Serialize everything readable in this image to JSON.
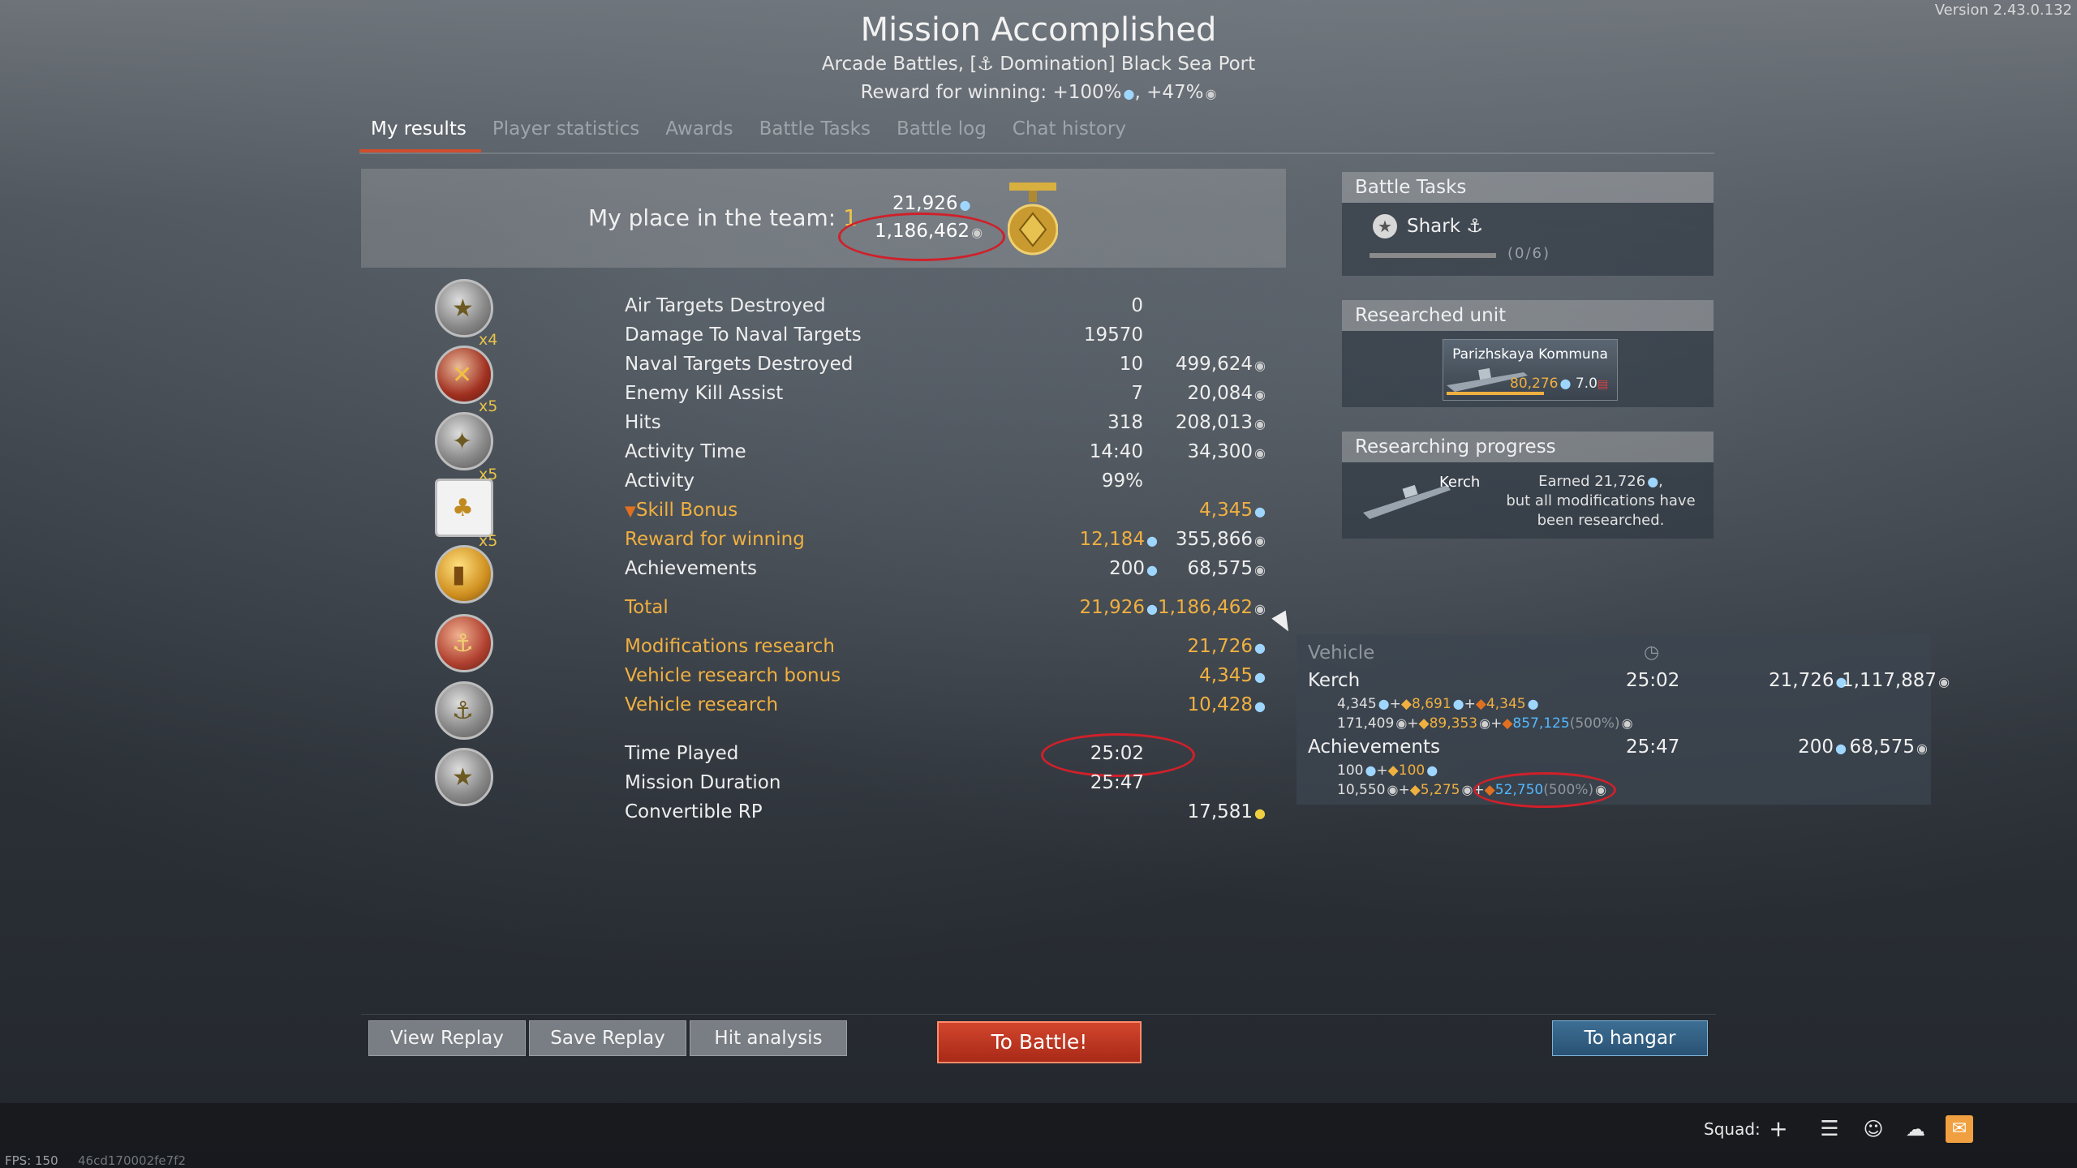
{
  "version": "Version 2.43.0.132",
  "header": {
    "title": "Mission Accomplished",
    "subtitle_prefix": "Arcade Battles, [",
    "subtitle_suffix": " Domination] Black Sea Port",
    "reward_text_1": "Reward for winning: +100%",
    "reward_text_2": ", +47%"
  },
  "tabs": [
    "My results",
    "Player statistics",
    "Awards",
    "Battle Tasks",
    "Battle log",
    "Chat history"
  ],
  "place": {
    "label": "My place in the team: ",
    "value": "1",
    "rp": "21,926",
    "sl": "1,186,462"
  },
  "stats": [
    {
      "label": "Air Targets Destroyed",
      "v1": "0",
      "v2": "",
      "gold": false
    },
    {
      "label": "Damage To Naval Targets",
      "v1": "19570",
      "v2": "",
      "gold": false
    },
    {
      "label": "Naval Targets Destroyed",
      "v1": "10",
      "v2": "499,624",
      "gold": false
    },
    {
      "label": "Enemy Kill Assist",
      "v1": "7",
      "v2": "20,084",
      "gold": false
    },
    {
      "label": "Hits",
      "v1": "318",
      "v2": "208,013",
      "gold": false
    },
    {
      "label": "Activity Time",
      "v1": "14:40",
      "v2": "34,300",
      "gold": false
    },
    {
      "label": "Activity",
      "v1": "99%",
      "v2": "",
      "gold": false
    },
    {
      "label": "Skill Bonus",
      "v1": "",
      "v2": "4,345",
      "gold": true
    },
    {
      "label": "Reward for winning",
      "v1": "12,184",
      "v2": "355,866",
      "gold": true
    },
    {
      "label": "Achievements",
      "v1": "200",
      "v2": "68,575",
      "gold": false
    },
    {
      "label": "Total",
      "v1": "21,926",
      "v2": "1,186,462",
      "gold": true
    },
    {
      "label": "Modifications research",
      "v1": "",
      "v2": "21,726",
      "gold": true
    },
    {
      "label": "Vehicle research bonus",
      "v1": "",
      "v2": "4,345",
      "gold": true
    },
    {
      "label": "Vehicle research",
      "v1": "",
      "v2": "10,428",
      "gold": true
    },
    {
      "label": "Time Played",
      "v1": "25:02",
      "v2": "",
      "gold": false
    },
    {
      "label": "Mission Duration",
      "v1": "25:47",
      "v2": "",
      "gold": false
    },
    {
      "label": "Convertible RP",
      "v1": "",
      "v2": "17,581",
      "gold": false
    }
  ],
  "multipliers": [
    "x4",
    "x5",
    "x5",
    "x5"
  ],
  "battle_tasks": {
    "header": "Battle Tasks",
    "task": "Shark",
    "progress": "(0/6)",
    "progress_fraction": 0
  },
  "researched_unit": {
    "header": "Researched unit",
    "name": "Parizhskaya Kommuna",
    "rp": "80,276",
    "br": "7.0"
  },
  "researching": {
    "header": "Researching progress",
    "vehicle": "Kerch",
    "line1": "Earned 21,726",
    "line2": "but all modifications have",
    "line3": "been researched."
  },
  "tooltip": {
    "header": "Vehicle",
    "row1": {
      "name": "Kerch",
      "time": "25:02",
      "rp": "21,726",
      "sl": "1,117,887"
    },
    "row1_sub1": {
      "a": "4,345",
      "b": "8,691",
      "c": "4,345"
    },
    "row1_sub2": {
      "a": "171,409",
      "b": "89,353",
      "c": "857,125",
      "d": "(500%)"
    },
    "row2": {
      "name": "Achievements",
      "time": "25:47",
      "rp": "200",
      "sl": "68,575"
    },
    "row2_sub1": {
      "a": "100",
      "b": "100"
    },
    "row2_sub2": {
      "a": "10,550",
      "b": "5,275",
      "c": "52,750",
      "d": "(500%)"
    }
  },
  "buttons": {
    "view_replay": "View Replay",
    "save_replay": "Save Replay",
    "hit_analysis": "Hit analysis",
    "to_battle": "To Battle!",
    "to_hangar": "To hangar"
  },
  "bottom": {
    "fps": "FPS: 150",
    "hash": "46cd170002fe7f2",
    "squad": "Squad:"
  },
  "colors": {
    "accent_tab": "#d04e2e",
    "gold": "#f0b040",
    "rp_blue": "#54b8ff",
    "battle_red": "#c2361f",
    "hangar_blue": "#2f5d82"
  }
}
